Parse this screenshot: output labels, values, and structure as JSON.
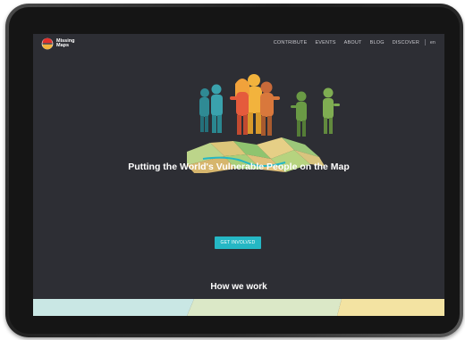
{
  "logo": {
    "line1": "Missing",
    "line2": "Maps"
  },
  "nav": {
    "items": [
      {
        "label": "CONTRIBUTE"
      },
      {
        "label": "EVENTS"
      },
      {
        "label": "ABOUT"
      },
      {
        "label": "BLOG"
      },
      {
        "label": "DISCOVER"
      }
    ],
    "language": "en"
  },
  "hero": {
    "headline": "Putting the World's Vulnerable People on the Map",
    "cta_label": "GET INVOLVED"
  },
  "section": {
    "title": "How we work"
  },
  "colors": {
    "background": "#2d2e34",
    "accent": "#25b7c4",
    "band_left": "#c9e7e4",
    "band_middle": "#dbe8c7",
    "band_right": "#f3e3a2"
  }
}
